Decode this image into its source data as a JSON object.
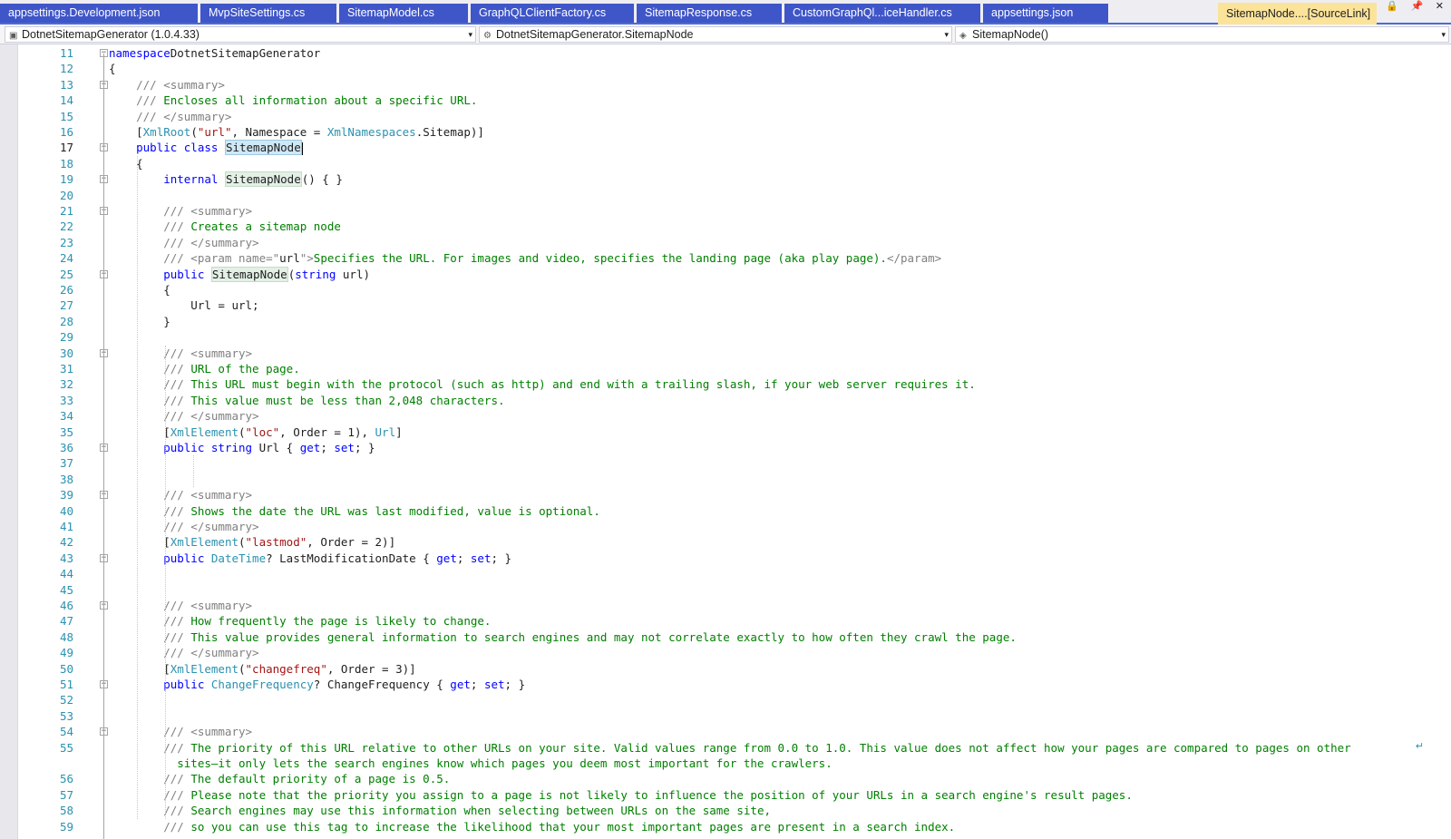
{
  "tabs": [
    {
      "label": "appsettings.Development.json",
      "active": false
    },
    {
      "label": "MvpSiteSettings.cs",
      "active": false
    },
    {
      "label": "SitemapModel.cs",
      "active": false
    },
    {
      "label": "GraphQLClientFactory.cs",
      "active": false
    },
    {
      "label": "SitemapResponse.cs",
      "active": false
    },
    {
      "label": "CustomGraphQl...iceHandler.cs",
      "active": false
    },
    {
      "label": "appsettings.json",
      "active": false
    },
    {
      "label": "SitemapNode....[SourceLink]",
      "active": true
    }
  ],
  "nav": {
    "project": "DotnetSitemapGenerator (1.0.4.33)",
    "type": "DotnetSitemapGenerator.SitemapNode",
    "member": "SitemapNode()"
  },
  "lines": [
    {
      "n": "11",
      "segs": [
        [
          "kw",
          "namespace"
        ],
        [
          "",
          "DotnetSitemapGenerator"
        ]
      ]
    },
    {
      "n": "12",
      "segs": [
        [
          "",
          "{"
        ]
      ]
    },
    {
      "n": "13",
      "segs": [
        [
          "cg",
          "    /// <summary>"
        ]
      ]
    },
    {
      "n": "14",
      "segs": [
        [
          "cg",
          "    /// "
        ],
        [
          "cm",
          "Encloses all information about a specific URL."
        ]
      ]
    },
    {
      "n": "15",
      "segs": [
        [
          "cg",
          "    /// </summary>"
        ]
      ]
    },
    {
      "n": "16",
      "segs": [
        [
          "",
          "    ["
        ],
        [
          "ty",
          "XmlRoot"
        ],
        [
          "",
          "("
        ],
        [
          "str",
          "\"url\""
        ],
        [
          "",
          ", Namespace = "
        ],
        [
          "ty",
          "XmlNamespaces"
        ],
        [
          "",
          ".Sitemap)]"
        ]
      ]
    },
    {
      "n": "17",
      "segs": [
        [
          "kw",
          "    public class "
        ],
        [
          "hl",
          "SitemapNode"
        ]
      ]
    },
    {
      "n": "18",
      "segs": [
        [
          "",
          "    {"
        ]
      ]
    },
    {
      "n": "19",
      "segs": [
        [
          "kw",
          "        internal "
        ],
        [
          "hl2",
          "SitemapNode"
        ],
        [
          "",
          "() { }"
        ]
      ]
    },
    {
      "n": "20",
      "segs": []
    },
    {
      "n": "21",
      "segs": [
        [
          "cg",
          "        /// <summary>"
        ]
      ]
    },
    {
      "n": "22",
      "segs": [
        [
          "cg",
          "        /// "
        ],
        [
          "cm",
          "Creates a sitemap node"
        ]
      ]
    },
    {
      "n": "23",
      "segs": [
        [
          "cg",
          "        /// </summary>"
        ]
      ]
    },
    {
      "n": "24",
      "segs": [
        [
          "cg",
          "        /// <param name=\""
        ],
        [
          "",
          "url"
        ],
        [
          "cg",
          "\">"
        ],
        [
          "cm",
          "Specifies the URL. For images and video, specifies the landing page (aka play page)."
        ],
        [
          "cg",
          "</param>"
        ]
      ]
    },
    {
      "n": "25",
      "segs": [
        [
          "kw",
          "        public "
        ],
        [
          "hl2",
          "SitemapNode"
        ],
        [
          "",
          "("
        ],
        [
          "kw",
          "string"
        ],
        [
          "",
          " url)"
        ]
      ]
    },
    {
      "n": "26",
      "segs": [
        [
          "",
          "        {"
        ]
      ]
    },
    {
      "n": "27",
      "segs": [
        [
          "",
          "            Url = url;"
        ]
      ]
    },
    {
      "n": "28",
      "segs": [
        [
          "",
          "        }"
        ]
      ]
    },
    {
      "n": "29",
      "segs": []
    },
    {
      "n": "30",
      "segs": [
        [
          "cg",
          "        /// <summary>"
        ]
      ]
    },
    {
      "n": "31",
      "segs": [
        [
          "cg",
          "        /// "
        ],
        [
          "cm",
          "URL of the page."
        ]
      ]
    },
    {
      "n": "32",
      "segs": [
        [
          "cg",
          "        /// "
        ],
        [
          "cm",
          "This URL must begin with the protocol (such as http) and end with a trailing slash, if your web server requires it."
        ]
      ]
    },
    {
      "n": "33",
      "segs": [
        [
          "cg",
          "        /// "
        ],
        [
          "cm",
          "This value must be less than 2,048 characters."
        ]
      ]
    },
    {
      "n": "34",
      "segs": [
        [
          "cg",
          "        /// </summary>"
        ]
      ]
    },
    {
      "n": "35",
      "segs": [
        [
          "",
          "        ["
        ],
        [
          "ty",
          "XmlElement"
        ],
        [
          "",
          "("
        ],
        [
          "str",
          "\"loc\""
        ],
        [
          "",
          ", Order = 1), "
        ],
        [
          "ty",
          "Url"
        ],
        [
          "",
          "]"
        ]
      ]
    },
    {
      "n": "36",
      "segs": [
        [
          "kw",
          "        public string "
        ],
        [
          "",
          "Url { "
        ],
        [
          "kw",
          "get"
        ],
        [
          "",
          "; "
        ],
        [
          "kw",
          "set"
        ],
        [
          "",
          "; }"
        ]
      ]
    },
    {
      "n": "37",
      "segs": []
    },
    {
      "n": "38",
      "segs": []
    },
    {
      "n": "39",
      "segs": [
        [
          "cg",
          "        /// <summary>"
        ]
      ]
    },
    {
      "n": "40",
      "segs": [
        [
          "cg",
          "        /// "
        ],
        [
          "cm",
          "Shows the date the URL was last modified, value is optional."
        ]
      ]
    },
    {
      "n": "41",
      "segs": [
        [
          "cg",
          "        /// </summary>"
        ]
      ]
    },
    {
      "n": "42",
      "segs": [
        [
          "",
          "        ["
        ],
        [
          "ty",
          "XmlElement"
        ],
        [
          "",
          "("
        ],
        [
          "str",
          "\"lastmod\""
        ],
        [
          "",
          ", Order = 2)]"
        ]
      ]
    },
    {
      "n": "43",
      "segs": [
        [
          "kw",
          "        public "
        ],
        [
          "ty",
          "DateTime"
        ],
        [
          "",
          "? LastModificationDate { "
        ],
        [
          "kw",
          "get"
        ],
        [
          "",
          "; "
        ],
        [
          "kw",
          "set"
        ],
        [
          "",
          "; }"
        ]
      ]
    },
    {
      "n": "44",
      "segs": []
    },
    {
      "n": "45",
      "segs": []
    },
    {
      "n": "46",
      "segs": [
        [
          "cg",
          "        /// <summary>"
        ]
      ]
    },
    {
      "n": "47",
      "segs": [
        [
          "cg",
          "        /// "
        ],
        [
          "cm",
          "How frequently the page is likely to change."
        ]
      ]
    },
    {
      "n": "48",
      "segs": [
        [
          "cg",
          "        /// "
        ],
        [
          "cm",
          "This value provides general information to search engines and may not correlate exactly to how often they crawl the page."
        ]
      ]
    },
    {
      "n": "49",
      "segs": [
        [
          "cg",
          "        /// </summary>"
        ]
      ]
    },
    {
      "n": "50",
      "segs": [
        [
          "",
          "        ["
        ],
        [
          "ty",
          "XmlElement"
        ],
        [
          "",
          "("
        ],
        [
          "str",
          "\"changefreq\""
        ],
        [
          "",
          ", Order = 3)]"
        ]
      ]
    },
    {
      "n": "51",
      "segs": [
        [
          "kw",
          "        public "
        ],
        [
          "ty",
          "ChangeFrequency"
        ],
        [
          "",
          "? ChangeFrequency { "
        ],
        [
          "kw",
          "get"
        ],
        [
          "",
          "; "
        ],
        [
          "kw",
          "set"
        ],
        [
          "",
          "; }"
        ]
      ]
    },
    {
      "n": "52",
      "segs": []
    },
    {
      "n": "53",
      "segs": []
    },
    {
      "n": "54",
      "segs": [
        [
          "cg",
          "        /// <summary>"
        ]
      ]
    },
    {
      "n": "55",
      "segs": [
        [
          "cg",
          "        /// "
        ],
        [
          "cm",
          "The priority of this URL relative to other URLs on your site. Valid values range from 0.0 to 1.0. This value does not affect how your pages are compared to pages on other"
        ]
      ]
    },
    {
      "n": "",
      "segs": [
        [
          "cm",
          "          sites—it only lets the search engines know which pages you deem most important for the crawlers."
        ]
      ]
    },
    {
      "n": "56",
      "segs": [
        [
          "cg",
          "        /// "
        ],
        [
          "cm",
          "The default priority of a page is 0.5."
        ]
      ]
    },
    {
      "n": "57",
      "segs": [
        [
          "cg",
          "        /// "
        ],
        [
          "cm",
          "Please note that the priority you assign to a page is not likely to influence the position of your URLs in a search engine's result pages."
        ]
      ]
    },
    {
      "n": "58",
      "segs": [
        [
          "cg",
          "        /// "
        ],
        [
          "cm",
          "Search engines may use this information when selecting between URLs on the same site,"
        ]
      ]
    },
    {
      "n": "59",
      "segs": [
        [
          "cg",
          "        /// "
        ],
        [
          "cm",
          "so you can use this tag to increase the likelihood that your most important pages are present in a search index."
        ]
      ]
    }
  ]
}
